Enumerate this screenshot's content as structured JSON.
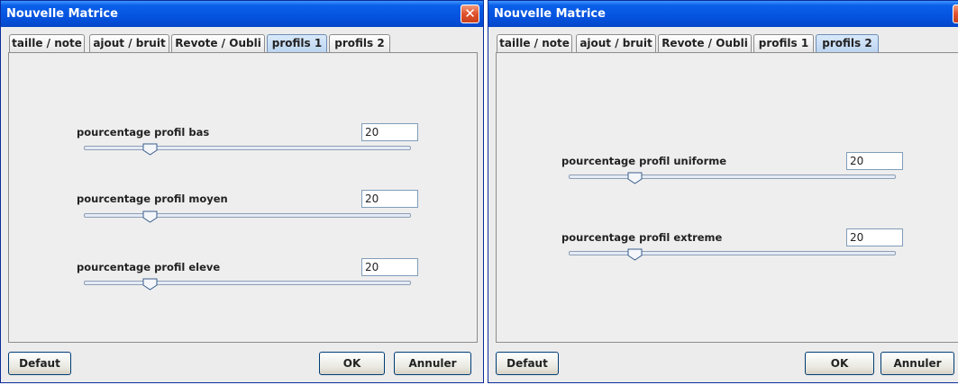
{
  "windows": [
    {
      "title": "Nouvelle Matrice",
      "tabs": [
        "taille / note",
        "ajout / bruit",
        "Revote / Oubli",
        "profils 1",
        "profils 2"
      ],
      "active_tab": "profils 1",
      "sliders": [
        {
          "label": "pourcentage profil bas",
          "value": "20",
          "level": 20
        },
        {
          "label": "pourcentage profil moyen",
          "value": "20",
          "level": 20
        },
        {
          "label": "pourcentage profil eleve",
          "value": "20",
          "level": 20
        }
      ],
      "buttons": {
        "default": "Defaut",
        "ok": "OK",
        "cancel": "Annuler"
      }
    },
    {
      "title": "Nouvelle Matrice",
      "tabs": [
        "taille / note",
        "ajout / bruit",
        "Revote / Oubli",
        "profils 1",
        "profils 2"
      ],
      "active_tab": "profils 2",
      "sliders": [
        {
          "label": "pourcentage profil uniforme",
          "value": "20",
          "level": 20
        },
        {
          "label": "pourcentage profil extreme",
          "value": "20",
          "level": 20
        }
      ],
      "buttons": {
        "default": "Defaut",
        "ok": "OK",
        "cancel": "Annuler"
      }
    }
  ],
  "colors": {
    "titlebar": "#0553e0",
    "active_tab": "#bcd4f0",
    "close_button": "#e0512c",
    "slider_thumb_border": "#3b5f8f"
  },
  "icons": {
    "close": "close-icon",
    "slider_thumb": "slider-thumb-icon"
  }
}
